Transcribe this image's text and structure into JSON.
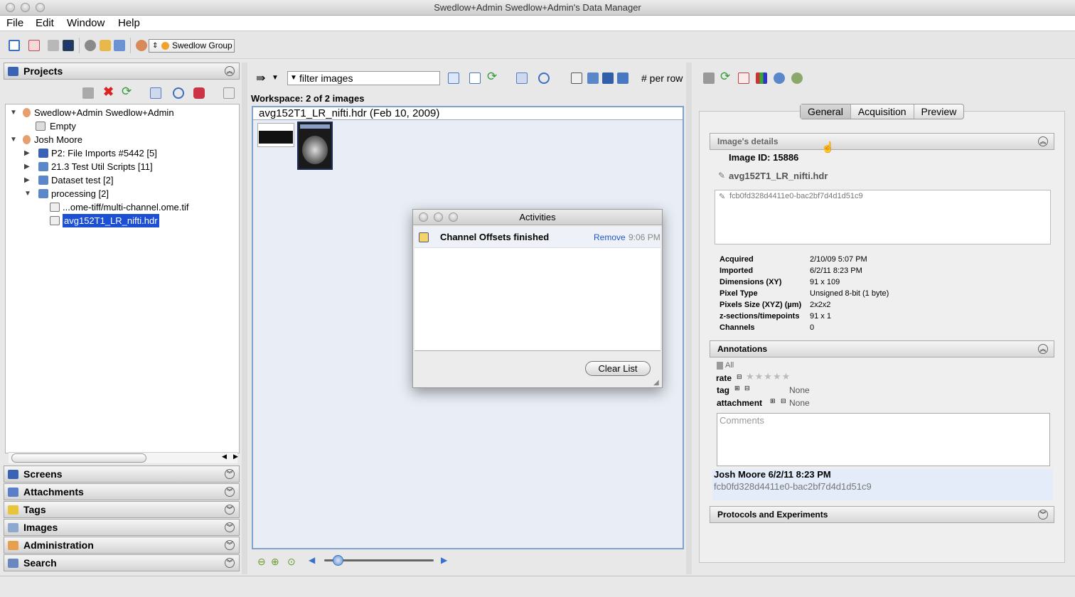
{
  "window": {
    "title": "Swedlow+Admin Swedlow+Admin's Data Manager"
  },
  "menu": {
    "items": [
      "File",
      "Edit",
      "Window",
      "Help"
    ]
  },
  "toolbar": {
    "group_label": "Swedlow Group"
  },
  "left": {
    "projects_header": "Projects",
    "tree": [
      {
        "label": "Swedlow+Admin Swedlow+Admin",
        "level": 0,
        "expanded": true,
        "icon": "user-icon"
      },
      {
        "label": "Empty",
        "level": 1,
        "expanded": null,
        "icon": "empty-icon"
      },
      {
        "label": "Josh Moore",
        "level": 0,
        "expanded": true,
        "icon": "user-icon"
      },
      {
        "label": "P2: File Imports #5442 [5]",
        "level": 1,
        "expanded": false,
        "icon": "folder-icon"
      },
      {
        "label": "21.3 Test Util Scripts [11]",
        "level": 1,
        "expanded": false,
        "icon": "dataset-icon"
      },
      {
        "label": "Dataset test [2]",
        "level": 1,
        "expanded": false,
        "icon": "dataset-icon"
      },
      {
        "label": "processing [2]",
        "level": 1,
        "expanded": true,
        "icon": "dataset-icon"
      },
      {
        "label": "...ome-tiff/multi-channel.ome.tif",
        "level": 2,
        "expanded": null,
        "icon": "image-icon"
      },
      {
        "label": "avg152T1_LR_nifti.hdr",
        "level": 2,
        "expanded": null,
        "icon": "image-icon",
        "selected": true
      }
    ],
    "panels": [
      {
        "label": "Screens",
        "icon": "screens-icon",
        "color": "#3a63b5"
      },
      {
        "label": "Attachments",
        "icon": "attachments-icon",
        "color": "#5a7ec8"
      },
      {
        "label": "Tags",
        "icon": "tags-icon",
        "color": "#e8c43a"
      },
      {
        "label": "Images",
        "icon": "images-icon",
        "color": "#8da9cf"
      },
      {
        "label": "Administration",
        "icon": "administration-icon",
        "color": "#e6a050"
      },
      {
        "label": "Search",
        "icon": "search-icon",
        "color": "#6a88c0"
      }
    ]
  },
  "center": {
    "filter_text": "filter  images",
    "per_row": "# per row",
    "workspace_label": "Workspace: 2 of 2 images",
    "workspace_title": "avg152T1_LR_nifti.hdr (Feb 10, 2009)"
  },
  "dialog": {
    "title": "Activities",
    "activity": "Channel Offsets finished",
    "remove_label": "Remove",
    "time": "9:06 PM",
    "clear_label": "Clear List"
  },
  "right": {
    "tabs": [
      "General",
      "Acquisition",
      "Preview"
    ],
    "details_header": "Image's details",
    "image_id": "Image ID: 15886",
    "image_name": "avg152T1_LR_nifti.hdr",
    "description": "fcb0fd328d4411e0-bac2bf7d4d1d51c9",
    "details": [
      {
        "label": "Acquired",
        "value": "2/10/09 5:07 PM"
      },
      {
        "label": "Imported",
        "value": "6/2/11 8:23 PM"
      },
      {
        "label": "Dimensions (XY)",
        "value": "91 x 109"
      },
      {
        "label": "Pixel Type",
        "value": "Unsigned 8-bit (1 byte)"
      },
      {
        "label": "Pixels Size (XYZ) (µm)",
        "value": "2x2x2"
      },
      {
        "label": "z-sections/timepoints",
        "value": "91 x 1"
      },
      {
        "label": "Channels",
        "value": "0"
      }
    ],
    "annotations_header": "Annotations",
    "all_label": "All",
    "rate_label": "rate",
    "tag_label": "tag",
    "tag_value": "None",
    "attachment_label": "attachment",
    "attachment_value": "None",
    "comments_placeholder": "Comments",
    "comment_author": "Josh Moore 6/2/11 8:23 PM",
    "comment_text": "fcb0fd328d4411e0-bac2bf7d4d1d51c9",
    "protocols_header": "Protocols and Experiments"
  }
}
